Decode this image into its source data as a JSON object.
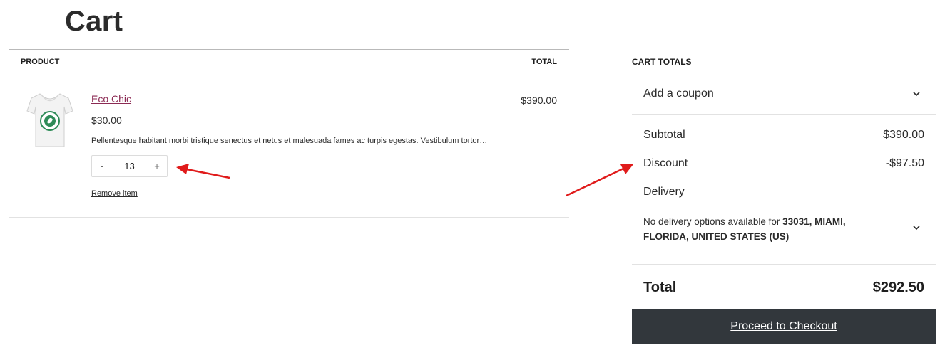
{
  "page": {
    "title": "Cart"
  },
  "cart": {
    "headers": {
      "product": "PRODUCT",
      "total": "TOTAL"
    },
    "items": [
      {
        "name": "Eco Chic",
        "price": "$30.00",
        "description": "Pellentesque habitant morbi tristique senectus et netus et malesuada fames ac turpis egestas. Vestibulum tortor…",
        "quantity": "13",
        "decrement_label": "-",
        "increment_label": "+",
        "remove_label": "Remove item",
        "line_total": "$390.00",
        "thumbnail_icon": "tshirt-image"
      }
    ]
  },
  "totals": {
    "heading": "CART TOTALS",
    "coupon_label": "Add a coupon",
    "subtotal_label": "Subtotal",
    "subtotal_value": "$390.00",
    "discount_label": "Discount",
    "discount_value": "-$97.50",
    "delivery_label": "Delivery",
    "delivery_note_prefix": "No delivery options available for ",
    "delivery_location": "33031, MIAMI, FLORIDA, UNITED STATES (US)",
    "total_label": "Total",
    "total_value": "$292.50",
    "checkout_label": "Proceed to Checkout"
  },
  "colors": {
    "link": "#8b2a53",
    "checkout_bg": "#32373c",
    "annotation_arrow": "#e01b1b"
  }
}
